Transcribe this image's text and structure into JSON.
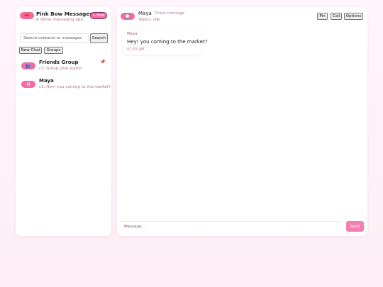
{
  "sidebar": {
    "brand_icon": "bow-icon",
    "brand_glyph": "🎀",
    "title": "Pink Bow Messages",
    "subtitle": "A demo messaging app",
    "new_label": "+ New",
    "search": {
      "placeholder": "Search contacts or messages",
      "value": ""
    },
    "search_button": "Search",
    "new_chat_button": "New Chat",
    "groups_button": "Groups",
    "contacts": [
      {
        "avatar": "👥",
        "avatar_icon": "group-icon",
        "name": "Friends Group",
        "preview": "c2: Group chat starts!",
        "pinned": true,
        "pin_glyph": "📌"
      },
      {
        "avatar": "M",
        "name": "Maya",
        "preview": "c1: Hey! you coming to the market?",
        "pinned": false
      }
    ]
  },
  "chat": {
    "header_icon": "chat-bubble-icon",
    "header_glyph": "💬",
    "name": "Maya",
    "type": "Direct message",
    "status": "Status: idle",
    "pin_label": "Pin",
    "call_label": "Call",
    "options_label": "Options",
    "messages": [
      {
        "author": "Maya",
        "text": "Hey! you coming to the market?",
        "time": "07:03 AM"
      }
    ],
    "compose": {
      "placeholder": "Message...",
      "value": ""
    },
    "send_label": "Send"
  },
  "colors": {
    "accent": "#f06ca6",
    "muted_text": "#b06a8c",
    "background": "#fff5fa"
  }
}
